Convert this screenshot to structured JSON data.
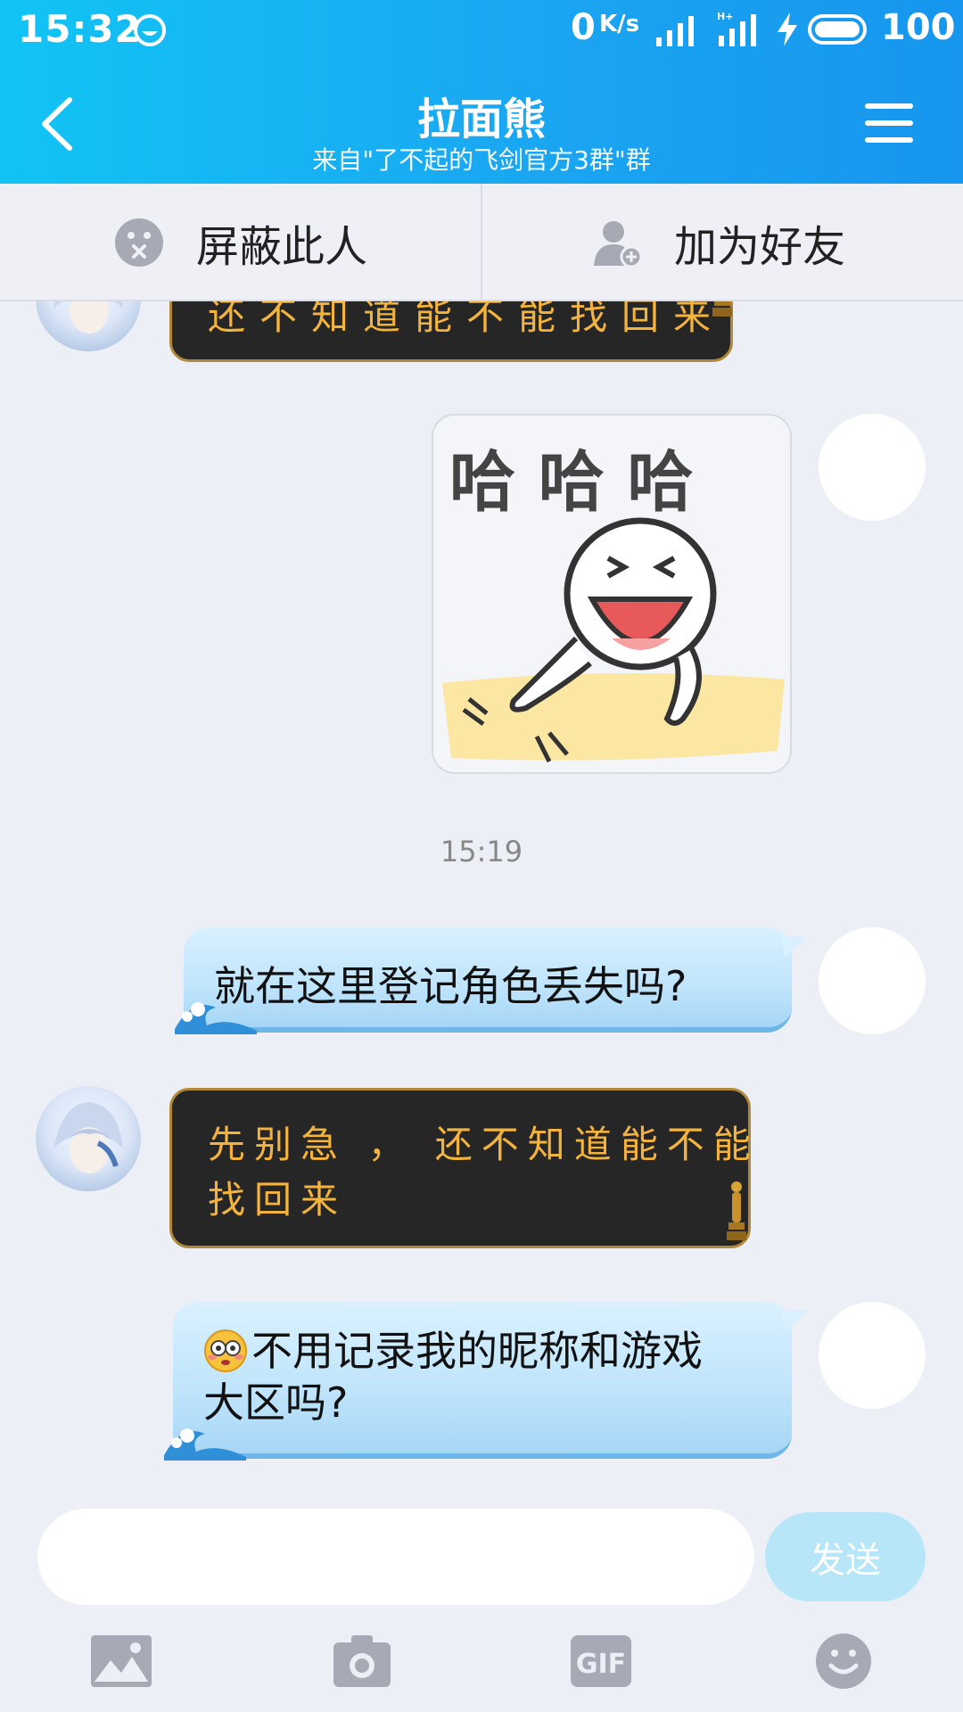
{
  "status_bar": {
    "time": "15:32",
    "net_speed": "0",
    "net_unit": "K/s",
    "battery": "100"
  },
  "header": {
    "title": "拉面熊",
    "subtitle": "来自\"了不起的飞剑官方3群\"群",
    "back_icon": "chevron-left-icon",
    "menu_icon": "hamburger-menu-icon"
  },
  "actions": {
    "block_label": "屏蔽此人",
    "add_friend_label": "加为好友"
  },
  "messages": [
    {
      "sender": "other",
      "type": "text",
      "text": "还不知道能不能找回来",
      "partial": true
    },
    {
      "sender": "me",
      "type": "sticker",
      "sticker_text": "哈 哈 哈"
    },
    {
      "sender": "me",
      "type": "text",
      "text": "就在这里登记角色丢失吗?"
    },
    {
      "sender": "other",
      "type": "text",
      "line1": "先别急 ， 还不知道能不能",
      "line2": "找回来"
    },
    {
      "sender": "me",
      "type": "text",
      "emoji": "flushed-face",
      "line1": "不用记录我的昵称和游戏",
      "line2": "大区吗?"
    }
  ],
  "timestamp": "15:19",
  "input": {
    "placeholder": "",
    "value": "",
    "send_label": "发送"
  },
  "toolbar": [
    "image-icon",
    "camera-icon",
    "gif-icon",
    "emoji-icon"
  ],
  "colors": {
    "header_start": "#11c4f5",
    "header_end": "#1696ee",
    "background": "#eceff6",
    "dark_bubble": "#262626",
    "dark_bubble_text": "#f3b33d",
    "blue_bubble": "#bfe4fb",
    "send_button": "#b6e6f8"
  }
}
